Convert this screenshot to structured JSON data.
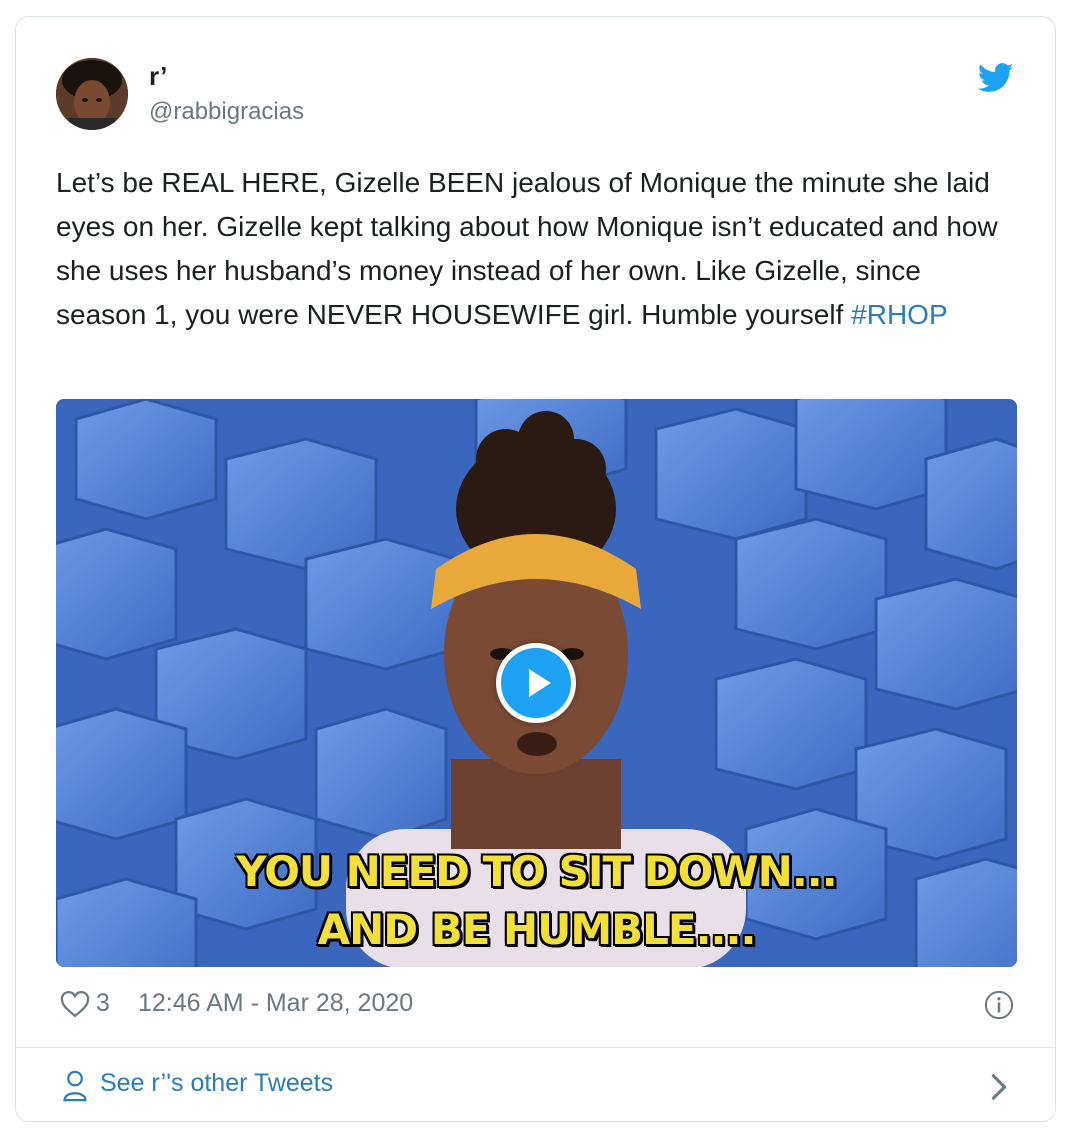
{
  "author": {
    "name": "r’",
    "handle": "@rabbigracias"
  },
  "tweet": {
    "text": "Let’s be REAL HERE, Gizelle BEEN jealous of Monique the minute she laid eyes on her. Gizelle kept talking about how Monique isn’t educated and how she uses her husband’s money instead of her own. Like Gizelle, since season 1, you were NEVER HOUSEWIFE girl. Humble yourself ",
    "hashtag": "#RHOP"
  },
  "media": {
    "type": "gif",
    "caption_line1": "YOU NEED TO SIT DOWN...",
    "caption_line2": "AND BE HUMBLE....",
    "play_icon": "play-icon"
  },
  "footer": {
    "like_count": "3",
    "timestamp": "12:46 AM - Mar 28, 2020"
  },
  "see_more": {
    "label": "See r’'s other Tweets"
  },
  "colors": {
    "link": "#2b7bb9",
    "twitter_blue": "#1da1f2",
    "muted": "#697882",
    "caption_yellow": "#f2df3a"
  },
  "icons": [
    "twitter-bird-icon",
    "heart-icon",
    "info-icon",
    "person-icon",
    "chevron-right-icon",
    "play-icon"
  ]
}
